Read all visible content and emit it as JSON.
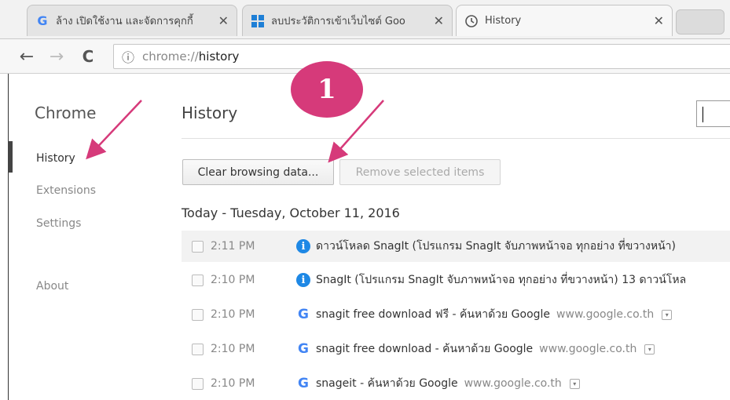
{
  "tabs": [
    {
      "title": "ล้าง เปิดใช้งาน และจัดการคุกกี้",
      "favicon": "google-g-icon",
      "active": false
    },
    {
      "title": "ลบประวัติการเข้าเว็บไซต์ Goo",
      "favicon": "windows-icon",
      "active": false
    },
    {
      "title": "History",
      "favicon": "history-clock-icon",
      "active": true
    }
  ],
  "toolbar": {
    "back_icon": "←",
    "forward_icon": "→",
    "reload_icon": "C",
    "info_icon": "ⓘ",
    "url_scheme": "chrome://",
    "url_host": "history"
  },
  "sidebar": {
    "title": "Chrome",
    "items": [
      {
        "label": "History",
        "selected": true
      },
      {
        "label": "Extensions",
        "selected": false
      },
      {
        "label": "Settings",
        "selected": false
      },
      {
        "label": "About",
        "selected": false
      }
    ]
  },
  "main": {
    "title": "History",
    "clear_button": "Clear browsing data...",
    "remove_button": "Remove selected items",
    "day_heading": "Today - Tuesday, October 11, 2016",
    "entries": [
      {
        "time": "2:11 PM",
        "icon": "info-icon",
        "title": "ดาวน์โหลด SnagIt (โปรแกรม SnagIt จับภาพหน้าจอ ทุกอย่าง ที่ขวางหน้า)",
        "domain": ""
      },
      {
        "time": "2:10 PM",
        "icon": "info-icon",
        "title": "SnagIt (โปรแกรม SnagIt จับภาพหน้าจอ ทุกอย่าง ที่ขวางหน้า) 13 ดาวน์โหล",
        "domain": ""
      },
      {
        "time": "2:10 PM",
        "icon": "google-g-icon",
        "title": "snagit free download ฟรี - ค้นหาด้วย Google",
        "domain": "www.google.co.th"
      },
      {
        "time": "2:10 PM",
        "icon": "google-g-icon",
        "title": "snagit free download - ค้นหาด้วย Google",
        "domain": "www.google.co.th"
      },
      {
        "time": "2:10 PM",
        "icon": "google-g-icon",
        "title": "snageit - ค้นหาด้วย Google",
        "domain": "www.google.co.th"
      }
    ]
  },
  "annotation": {
    "badge_text": "1",
    "color": "#d63a7a"
  }
}
